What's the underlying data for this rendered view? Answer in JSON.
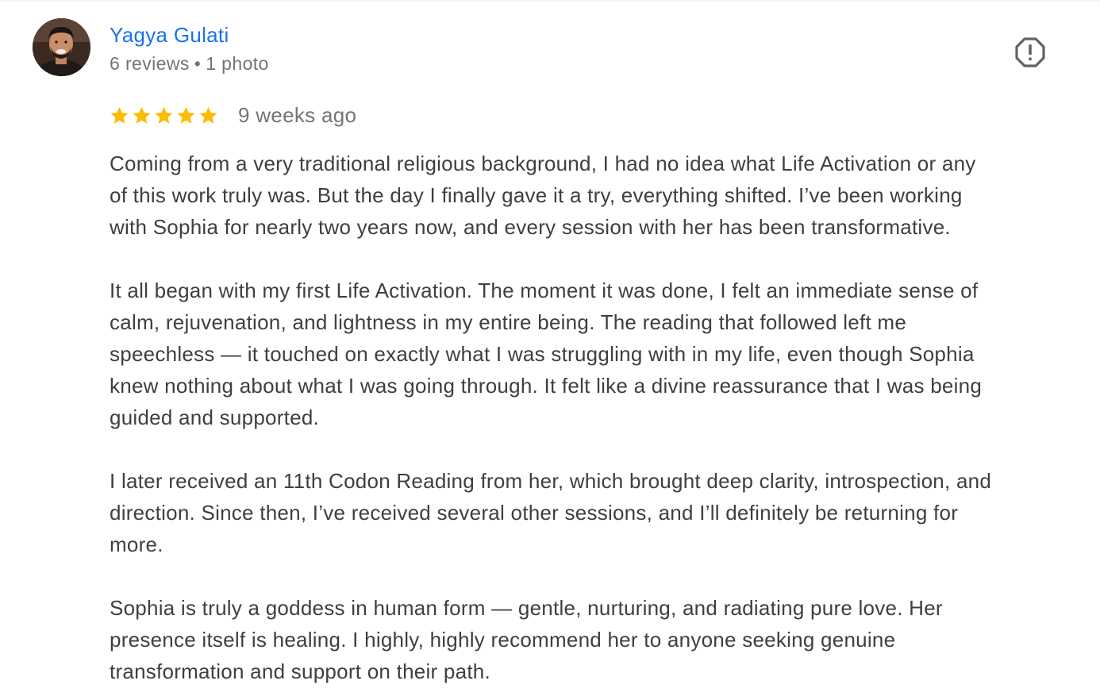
{
  "review": {
    "author": {
      "name": "Yagya Gulati",
      "review_count": "6 reviews",
      "separator": "•",
      "photo_count": "1 photo",
      "avatar_icon": "profile-photo"
    },
    "rating": {
      "stars": 5,
      "max_stars": 5,
      "star_color": "#fbbc04"
    },
    "date": "9 weeks ago",
    "report_icon": "report-flag-icon",
    "paragraphs": [
      "Coming from a very traditional religious background, I had no idea what Life Activation or any\nof this work truly was. But the day I finally gave it a try, everything shifted. I’ve been working\nwith Sophia for nearly two years now, and every session with her has been transformative.",
      "It all began with my first Life Activation. The moment it was done, I felt an immediate sense of\ncalm, rejuvenation, and lightness in my entire being. The reading that followed left me\nspeechless — it touched on exactly what I was struggling with in my life, even though Sophia\nknew nothing about what I was going through. It felt like a divine reassurance that I was being\nguided and supported.",
      "I later received an 11th Codon Reading from her, which brought deep clarity, introspection, and\ndirection. Since then, I’ve received several other sessions, and I’ll definitely be returning for\nmore.",
      "Sophia is truly a goddess in human form — gentle, nurturing, and radiating pure love. Her\npresence itself is healing. I highly, highly recommend her to anyone seeking genuine\ntransformation and support on their path."
    ]
  },
  "colors": {
    "author_link": "#1a73e8",
    "meta_text": "#70757a",
    "body_text": "#3c4043",
    "icon": "#5f6368"
  }
}
